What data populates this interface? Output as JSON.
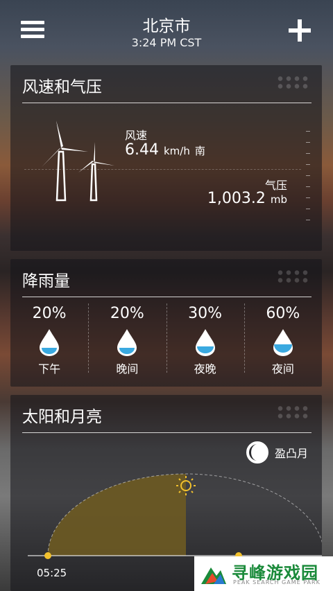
{
  "header": {
    "city": "北京市",
    "time": "3:24 PM CST"
  },
  "wind_card": {
    "title": "风速和气压",
    "wind_label": "风速",
    "wind_value": "6.44",
    "wind_unit": "km/h",
    "wind_direction": "南",
    "pressure_label": "气压",
    "pressure_value": "1,003.2",
    "pressure_unit": "mb"
  },
  "rain_card": {
    "title": "降雨量",
    "items": [
      {
        "pct": "20%",
        "label": "下午"
      },
      {
        "pct": "20%",
        "label": "晚间"
      },
      {
        "pct": "30%",
        "label": "夜晚"
      },
      {
        "pct": "60%",
        "label": "夜间"
      }
    ]
  },
  "sun_card": {
    "title": "太阳和月亮",
    "moon_phase": "盈凸月",
    "sunrise": "05:25",
    "sun_color": "#f2c12e",
    "arc_fill": "#6d5a22"
  },
  "watermark": {
    "title": "寻峰游戏园",
    "subtitle": "PEAK SEARCH GAME PARK"
  }
}
